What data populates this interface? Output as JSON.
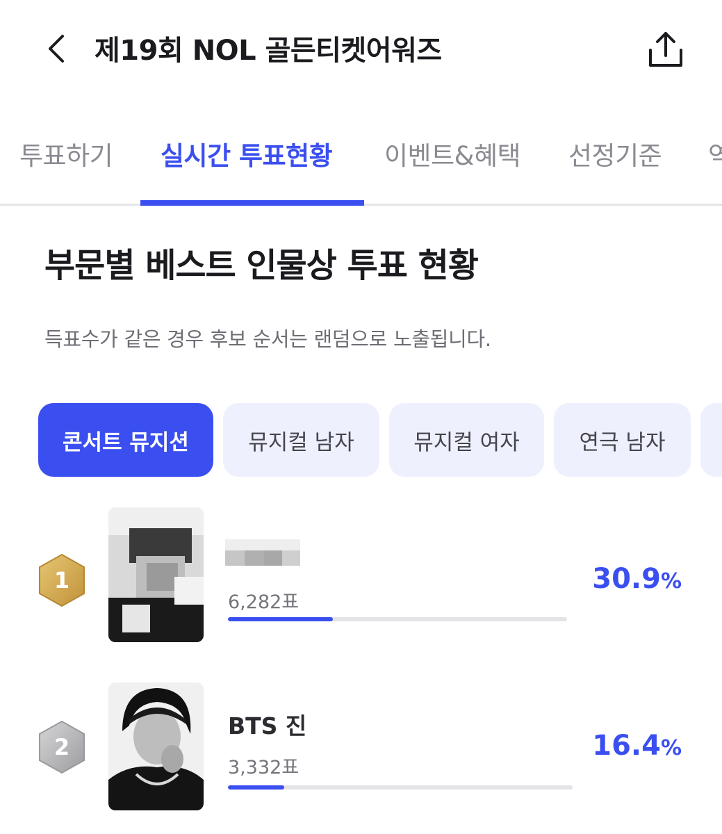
{
  "header": {
    "title": "제19회 NOL 골든티켓어워즈",
    "back_icon": "chevron-left-icon",
    "share_icon": "share-icon"
  },
  "tabs": [
    {
      "label": "투표하기",
      "active": false
    },
    {
      "label": "실시간 투표현황",
      "active": true
    },
    {
      "label": "이벤트&혜택",
      "active": false
    },
    {
      "label": "선정기준",
      "active": false
    },
    {
      "label": "역",
      "active": false
    }
  ],
  "section": {
    "title": "부문별 베스트 인물상 투표 현황",
    "note": "득표수가 같은 경우 후보 순서는 랜덤으로 노출됩니다."
  },
  "categories": [
    {
      "label": "콘서트 뮤지션",
      "active": true
    },
    {
      "label": "뮤지컬 남자",
      "active": false
    },
    {
      "label": "뮤지컬 여자",
      "active": false
    },
    {
      "label": "연극 남자",
      "active": false
    }
  ],
  "ranking": [
    {
      "rank": "1",
      "name": "",
      "votes": "6,282표",
      "percent": "30.9",
      "unit": "%",
      "bar_fraction": 0.309,
      "medal_color": "#d4a94f"
    },
    {
      "rank": "2",
      "name": "BTS 진",
      "votes": "3,332표",
      "percent": "16.4",
      "unit": "%",
      "bar_fraction": 0.164,
      "medal_color": "#b5b5b8"
    }
  ],
  "colors": {
    "accent": "#3b4ff0",
    "chip_inactive": "#eef0fd",
    "muted_text": "#8a8a92"
  }
}
